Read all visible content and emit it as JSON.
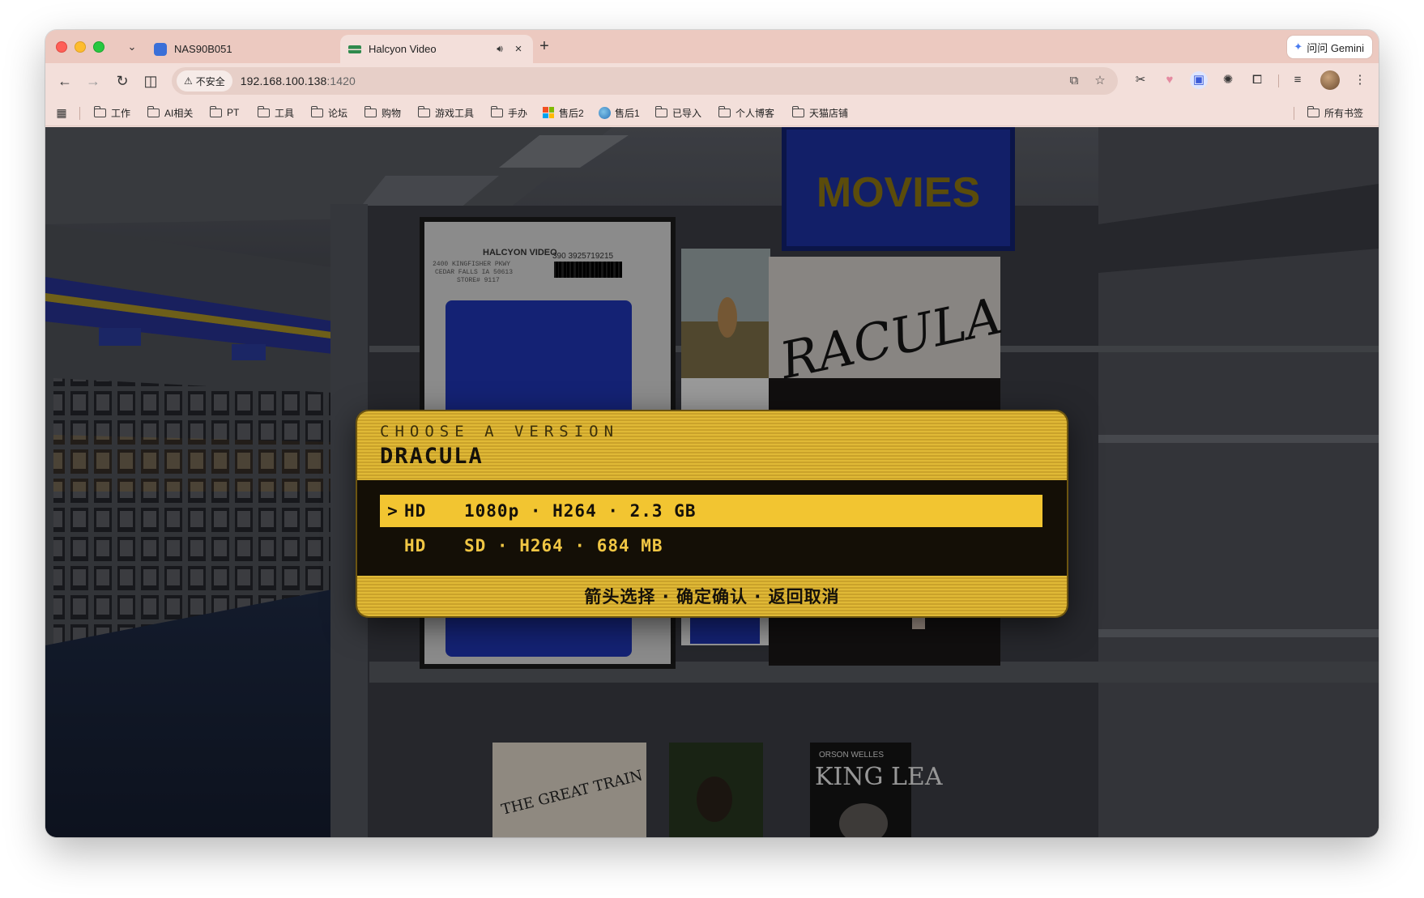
{
  "browser": {
    "tabs": [
      {
        "title": "NAS90B051",
        "active": false,
        "favicon": "nas-favicon"
      },
      {
        "title": "Halcyon Video",
        "active": true,
        "favicon": "halcyon-favicon",
        "audio": true
      }
    ],
    "gemini_label": "问问 Gemini",
    "security_label": "不安全",
    "url_host": "192.168.100.138",
    "url_port": ":1420",
    "bookmarks": [
      "工作",
      "AI相关",
      "PT",
      "工具",
      "论坛",
      "购物",
      "游戏工具",
      "手办",
      "售后2",
      "售后1",
      "已导入",
      "个人博客",
      "天猫店铺"
    ],
    "all_bookmarks": "所有书签"
  },
  "scene": {
    "sign_text": "MOVIES",
    "vhs_label_line1": "HALCYON VIDEO",
    "vhs_label_line2": "2400 KINGFISHER PKWY",
    "vhs_label_line3": "CEDAR FALLS IA 50613",
    "vhs_label_line4": "STORE# 9117",
    "vhs_barcode_number": "390 3925719215",
    "dracula_poster_text": "RACULA",
    "great_train_text": "THE GREAT TRAIN",
    "king_lear_byline": "ORSON WELLES",
    "king_lear_title": "KING LEA"
  },
  "dialog": {
    "kicker": "CHOOSE A VERSION",
    "title": "DRACULA",
    "options": [
      {
        "cursor": ">",
        "tier": "HD",
        "spec": "1080p · H264 · 2.3 GB",
        "selected": true
      },
      {
        "cursor": "",
        "tier": "HD",
        "spec": "SD · H264 · 684 MB",
        "selected": false
      }
    ],
    "hint": "箭头选择 · 确定确认 · 返回取消"
  },
  "colors": {
    "accent_yellow": "#f2c531",
    "dialog_body": "#140f06",
    "sign_blue": "#1c2f9e",
    "sign_text": "#8a7412"
  }
}
